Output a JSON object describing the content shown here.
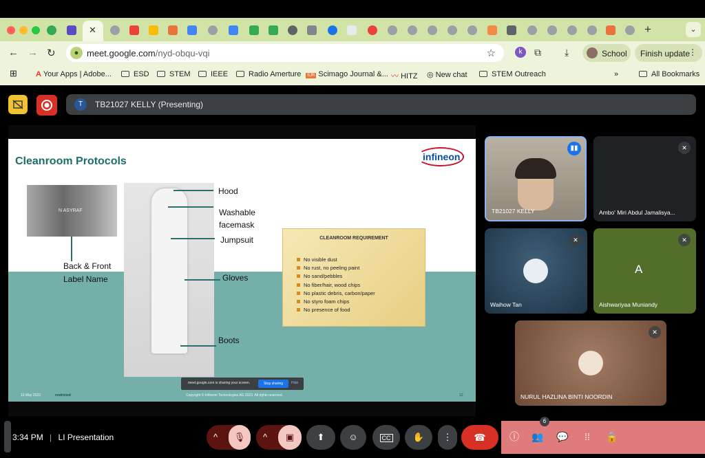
{
  "browser": {
    "url_domain": "meet.google.com",
    "url_path": "/nyd-obqu-vqi",
    "profile_label": "School",
    "finish_update_label": "Finish update",
    "bookmarks": [
      "Your Apps | Adobe...",
      "ESD",
      "STEM",
      "IEEE",
      "Radio Amerture",
      "Scimago Journal &...",
      "HITZ",
      "New chat",
      "STEM Outreach"
    ],
    "all_bookmarks": "All Bookmarks",
    "more_bookmarks": "»"
  },
  "meet": {
    "presenter_initial": "T",
    "presenter_label": "TB21027 KELLY (Presenting)",
    "time": "3:34 PM",
    "separator": "|",
    "meeting_name": "LI Presentation",
    "participant_count": "6"
  },
  "slide": {
    "title": "Cleanroom Protocols",
    "logo_text": "infineon",
    "photo_caption": "N ASYRAF",
    "labels": {
      "hood": "Hood",
      "facemask": "Washable facemask",
      "jumpsuit": "Jumpsuit",
      "gloves": "Gloves",
      "boots": "Boots",
      "back_front": "Back & Front Label Name"
    },
    "requirement_title": "CLEANROOM REQUIREMENT",
    "requirements": [
      "No visible dust",
      "No rust,  no peeling paint",
      "No sand/pebbles",
      "No fiber/hair, wood chips",
      "No plastic debris, carbon/paper",
      "No styro foam chips",
      "No presence of food"
    ],
    "footer_date": "10 May 2023",
    "footer_restricted": "restricted",
    "footer_copyright": "Copyright © Infineon Technologies AG 2023. All rights reserved.",
    "page_number": "12",
    "share_notice": "meet.google.com is sharing your screen.",
    "stop_sharing": "Stop sharing",
    "hide": "Hide"
  },
  "participants": [
    {
      "name": "TB21027 KELLY"
    },
    {
      "name": "Ambo' Miri Abdul Jamalisya..."
    },
    {
      "name": "Waihow Tan"
    },
    {
      "name": "Aishwariyaa Muniandy",
      "initial": "A"
    },
    {
      "name": "NURUL HAZLINA BINTI NOORDIN"
    }
  ],
  "colors": {
    "chrome": "#d2e3a8",
    "slide_teal": "#74afa9",
    "title_teal": "#1c6e67",
    "end_call": "#d93025",
    "side_panel": "#e07b7b"
  }
}
